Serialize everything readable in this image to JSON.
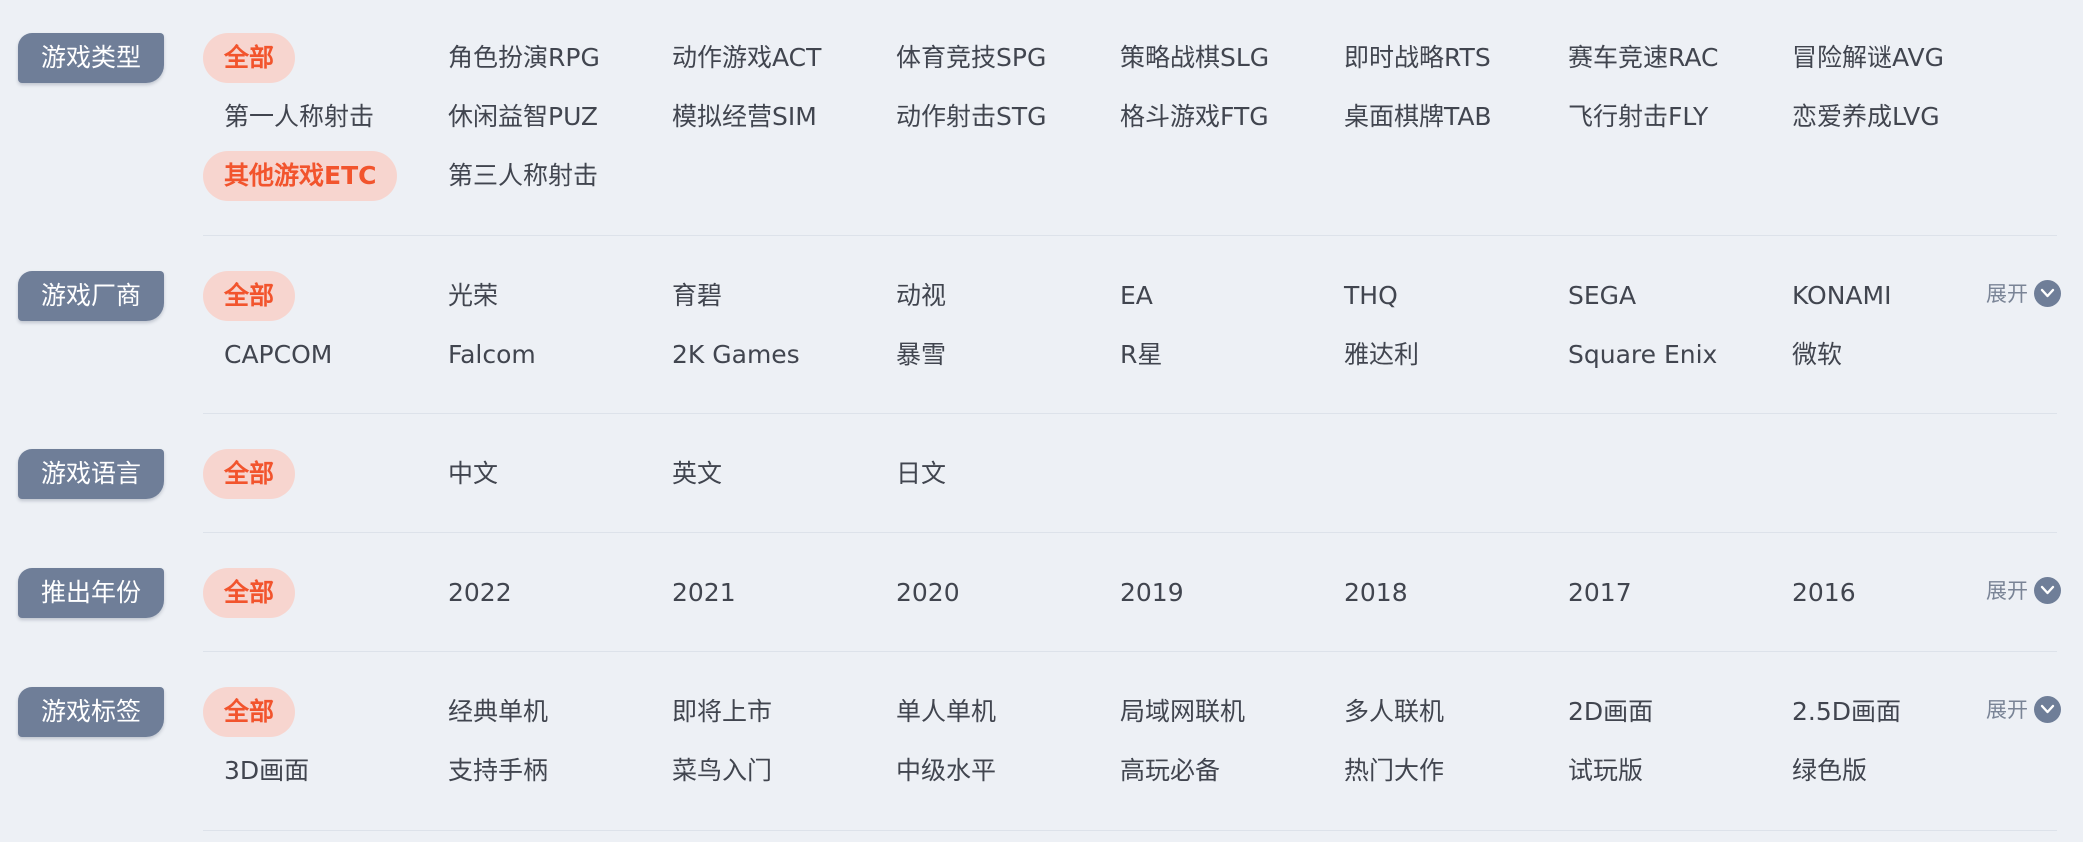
{
  "filters": {
    "genre": {
      "label": "游戏类型",
      "options": [
        "全部",
        "角色扮演RPG",
        "动作游戏ACT",
        "体育竞技SPG",
        "策略战棋SLG",
        "即时战略RTS",
        "赛车竞速RAC",
        "冒险解谜AVG",
        "第一人称射击",
        "休闲益智PUZ",
        "模拟经营SIM",
        "动作射击STG",
        "格斗游戏FTG",
        "桌面棋牌TAB",
        "飞行射击FLY",
        "恋爱养成LVG",
        "其他游戏ETC",
        "第三人称射击"
      ],
      "active": [
        "全部",
        "其他游戏ETC"
      ]
    },
    "publisher": {
      "label": "游戏厂商",
      "options": [
        "全部",
        "光荣",
        "育碧",
        "动视",
        "EA",
        "THQ",
        "SEGA",
        "KONAMI",
        "CAPCOM",
        "Falcom",
        "2K Games",
        "暴雪",
        "R星",
        "雅达利",
        "Square Enix",
        "微软"
      ],
      "active": [
        "全部"
      ],
      "expand_label": "展开"
    },
    "language": {
      "label": "游戏语言",
      "options": [
        "全部",
        "中文",
        "英文",
        "日文"
      ],
      "active": [
        "全部"
      ]
    },
    "year": {
      "label": "推出年份",
      "options": [
        "全部",
        "2022",
        "2021",
        "2020",
        "2019",
        "2018",
        "2017",
        "2016"
      ],
      "active": [
        "全部"
      ],
      "expand_label": "展开"
    },
    "tags": {
      "label": "游戏标签",
      "options": [
        "全部",
        "经典单机",
        "即将上市",
        "单人单机",
        "局域网联机",
        "多人联机",
        "2D画面",
        "2.5D画面",
        "3D画面",
        "支持手柄",
        "菜鸟入门",
        "中级水平",
        "高玩必备",
        "热门大作",
        "试玩版",
        "绿色版"
      ],
      "active": [
        "全部"
      ],
      "expand_label": "展开"
    }
  },
  "colors": {
    "background": "#edf0f5",
    "label_bg": "#6f7e98",
    "active_bg": "#f7d5cf",
    "active_text": "#f2542d",
    "text": "#41454f",
    "divider": "#dde2ea"
  },
  "icons": {
    "expand": "chevron-down-icon"
  }
}
